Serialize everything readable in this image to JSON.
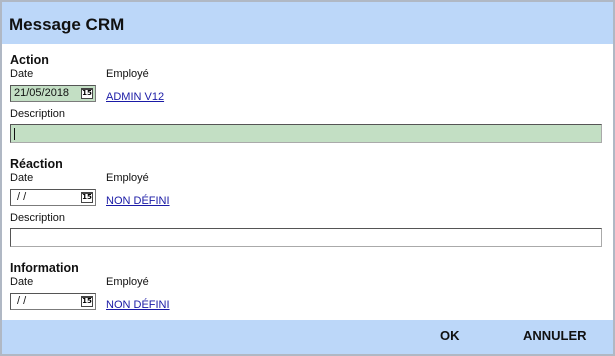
{
  "title": "Message CRM",
  "labels": {
    "date": "Date",
    "employe": "Employé",
    "description": "Description"
  },
  "action": {
    "heading": "Action",
    "date_value": "21/05/2018",
    "employe": "ADMIN V12",
    "description_value": ""
  },
  "reaction": {
    "heading": "Réaction",
    "date_value": " / /",
    "employe": "NON DÉFINI",
    "description_value": ""
  },
  "information": {
    "heading": "Information",
    "date_value": " / /",
    "employe": "NON DÉFINI"
  },
  "icons": {
    "calendar": "15"
  },
  "buttons": {
    "ok": "OK",
    "cancel": "ANNULER"
  },
  "colors": {
    "header_bg": "#bcd7f9",
    "active_field_bg": "#c3dfc4",
    "link": "#1a1aa6"
  }
}
